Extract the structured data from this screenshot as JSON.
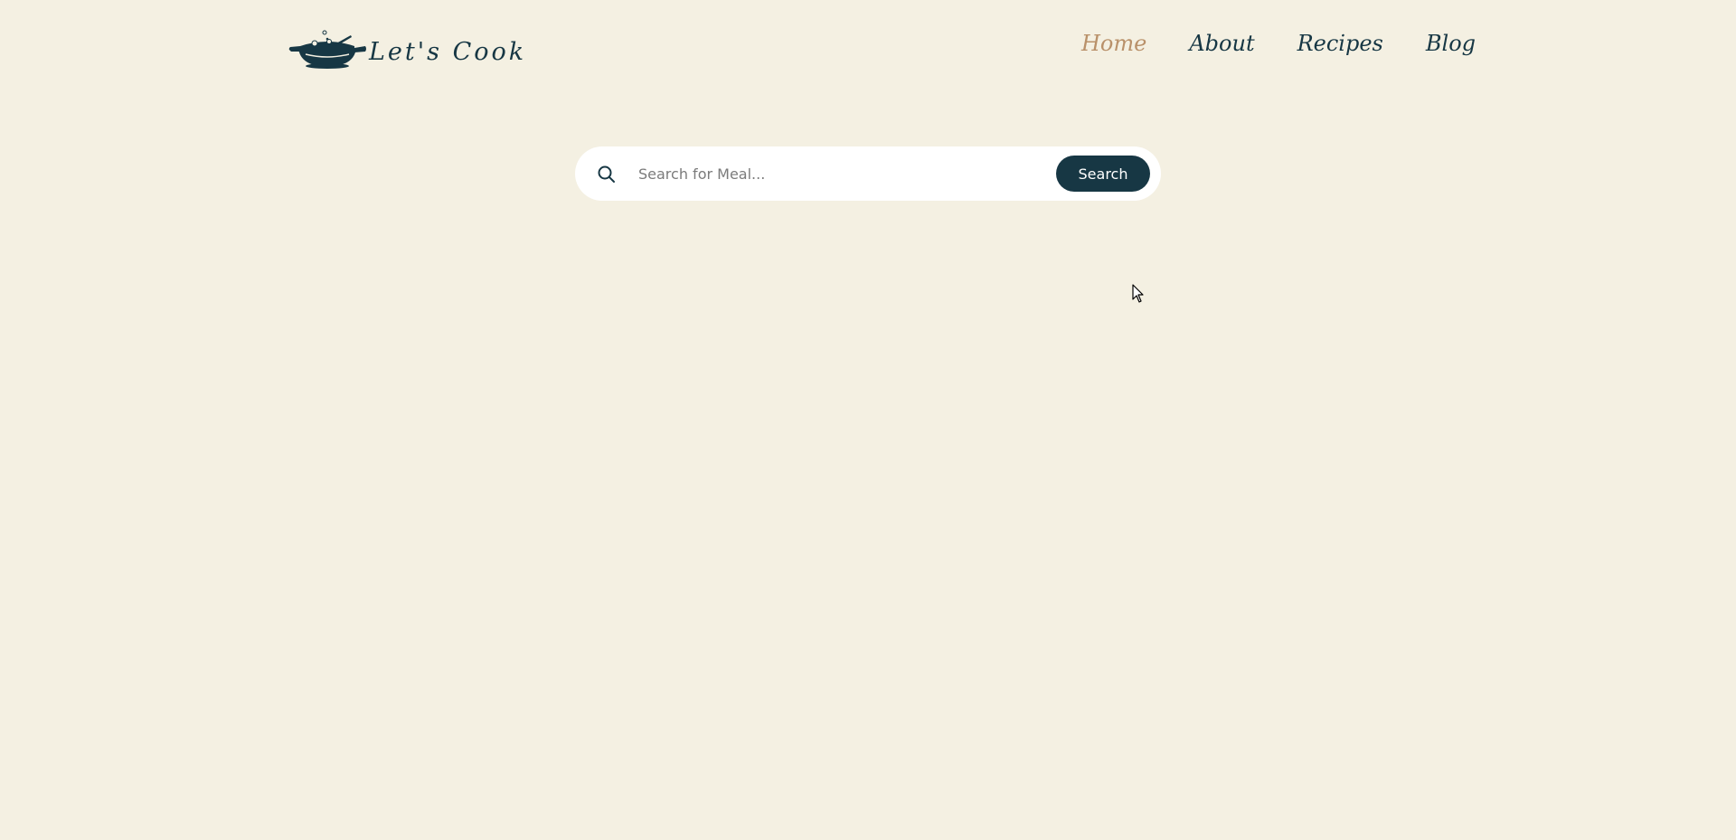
{
  "header": {
    "logo_text": "Let's Cook",
    "nav": [
      {
        "label": "Home",
        "active": true
      },
      {
        "label": "About",
        "active": false
      },
      {
        "label": "Recipes",
        "active": false
      },
      {
        "label": "Blog",
        "active": false
      }
    ]
  },
  "search": {
    "icon": "search-icon",
    "placeholder": "Search for Meal...",
    "value": "",
    "button_label": "Search"
  },
  "colors": {
    "background": "#f4f0e2",
    "primary": "#173744",
    "accent": "#b9916a",
    "surface": "#ffffff"
  }
}
